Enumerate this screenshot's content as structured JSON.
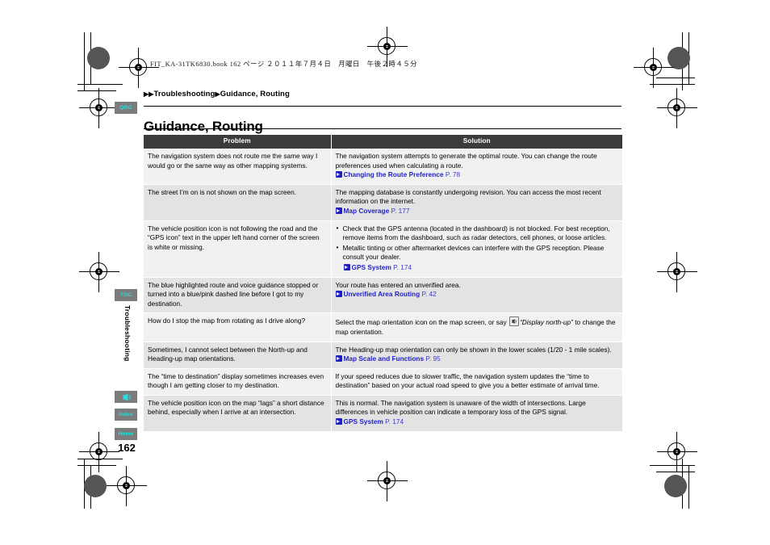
{
  "print_slug": "FIT_KA-31TK6830.book   162 ページ   ２０１１年７月４日　月曜日　午後２時４５分",
  "breadcrumb": {
    "arrow": "▶",
    "item1": "Troubleshooting",
    "item2": "Guidance, Routing"
  },
  "page_title": "Guidance, Routing",
  "page_number": "162",
  "sidebar": {
    "tabs": [
      {
        "id": "qrg",
        "label": "QRG"
      },
      {
        "id": "toc",
        "label": "TOC"
      },
      {
        "id": "voice",
        "label": "",
        "icon": "voice-command-icon"
      },
      {
        "id": "index",
        "label": "Index"
      },
      {
        "id": "home",
        "label": "Home"
      }
    ],
    "section_label": "Troubleshooting",
    "tab_bg": "#7c7c7c",
    "tab_fg": "#2ddcd8"
  },
  "table": {
    "headers": [
      "Problem",
      "Solution"
    ],
    "header_bg": "#3b3b3b",
    "rows": [
      {
        "problem": "The navigation system does not route me the same way I would go or the same way as other mapping systems.",
        "solution_text": "The navigation system attempts to generate the optimal route. You can change the route preferences used when calculating a route.",
        "refs": [
          {
            "title": "Changing the Route Preference",
            "page": "P. 78"
          }
        ]
      },
      {
        "problem": "The street I’m on is not shown on the map screen.",
        "solution_text": "The mapping database is constantly undergoing revision. You can access the most recent information on the internet.",
        "refs": [
          {
            "title": "Map Coverage",
            "page": "P. 177"
          }
        ]
      },
      {
        "problem": "The vehicle position icon is not following the road and the “GPS icon” text in the upper left hand corner of the screen is white or missing.",
        "bullets": [
          "Check that the GPS antenna (located in the dashboard) is not blocked. For best reception, remove items from the dashboard, such as radar detectors, cell phones, or loose articles.",
          "Metallic tinting or other aftermarket devices can interfere with the GPS reception. Please consult your dealer."
        ],
        "refs": [
          {
            "title": "GPS System",
            "page": "P. 174",
            "indent": true
          }
        ]
      },
      {
        "problem": "The blue highlighted route and voice guidance stopped or turned into a blue/pink dashed line before I got to my destination.",
        "solution_text": "Your route has entered an unverified area.",
        "refs": [
          {
            "title": "Unverified Area Routing",
            "page": "P. 42"
          }
        ]
      },
      {
        "problem": "How do I stop the map from rotating as I drive along?",
        "solution_pre": "Select the map orientation icon on the map screen, or say ",
        "solution_italic": "“Display north-up”",
        "solution_post": " to change the map orientation.",
        "has_voice_icon": true
      },
      {
        "problem": "Sometimes, I cannot select between the North-up and Heading-up map orientations.",
        "solution_text": "The Heading-up map orientation can only be shown in the lower scales (1/20 - 1 mile scales).",
        "refs": [
          {
            "title": "Map Scale and Functions",
            "page": "P. 95"
          }
        ]
      },
      {
        "problem": "The “time to destination” display sometimes increases even though I am getting closer to my destination.",
        "solution_text": "If your speed reduces due to slower traffic, the navigation system updates the “time to destination” based on your actual road speed to give you a better estimate of arrival time."
      },
      {
        "problem": "The vehicle position icon on the map “lags” a short distance behind, especially when I arrive at an intersection.",
        "solution_text": "This is normal. The navigation system is unaware of the width of intersections. Large differences in vehicle position can indicate a temporary loss of the GPS signal.",
        "refs": [
          {
            "title": "GPS System",
            "page": "P. 174"
          }
        ]
      }
    ]
  }
}
